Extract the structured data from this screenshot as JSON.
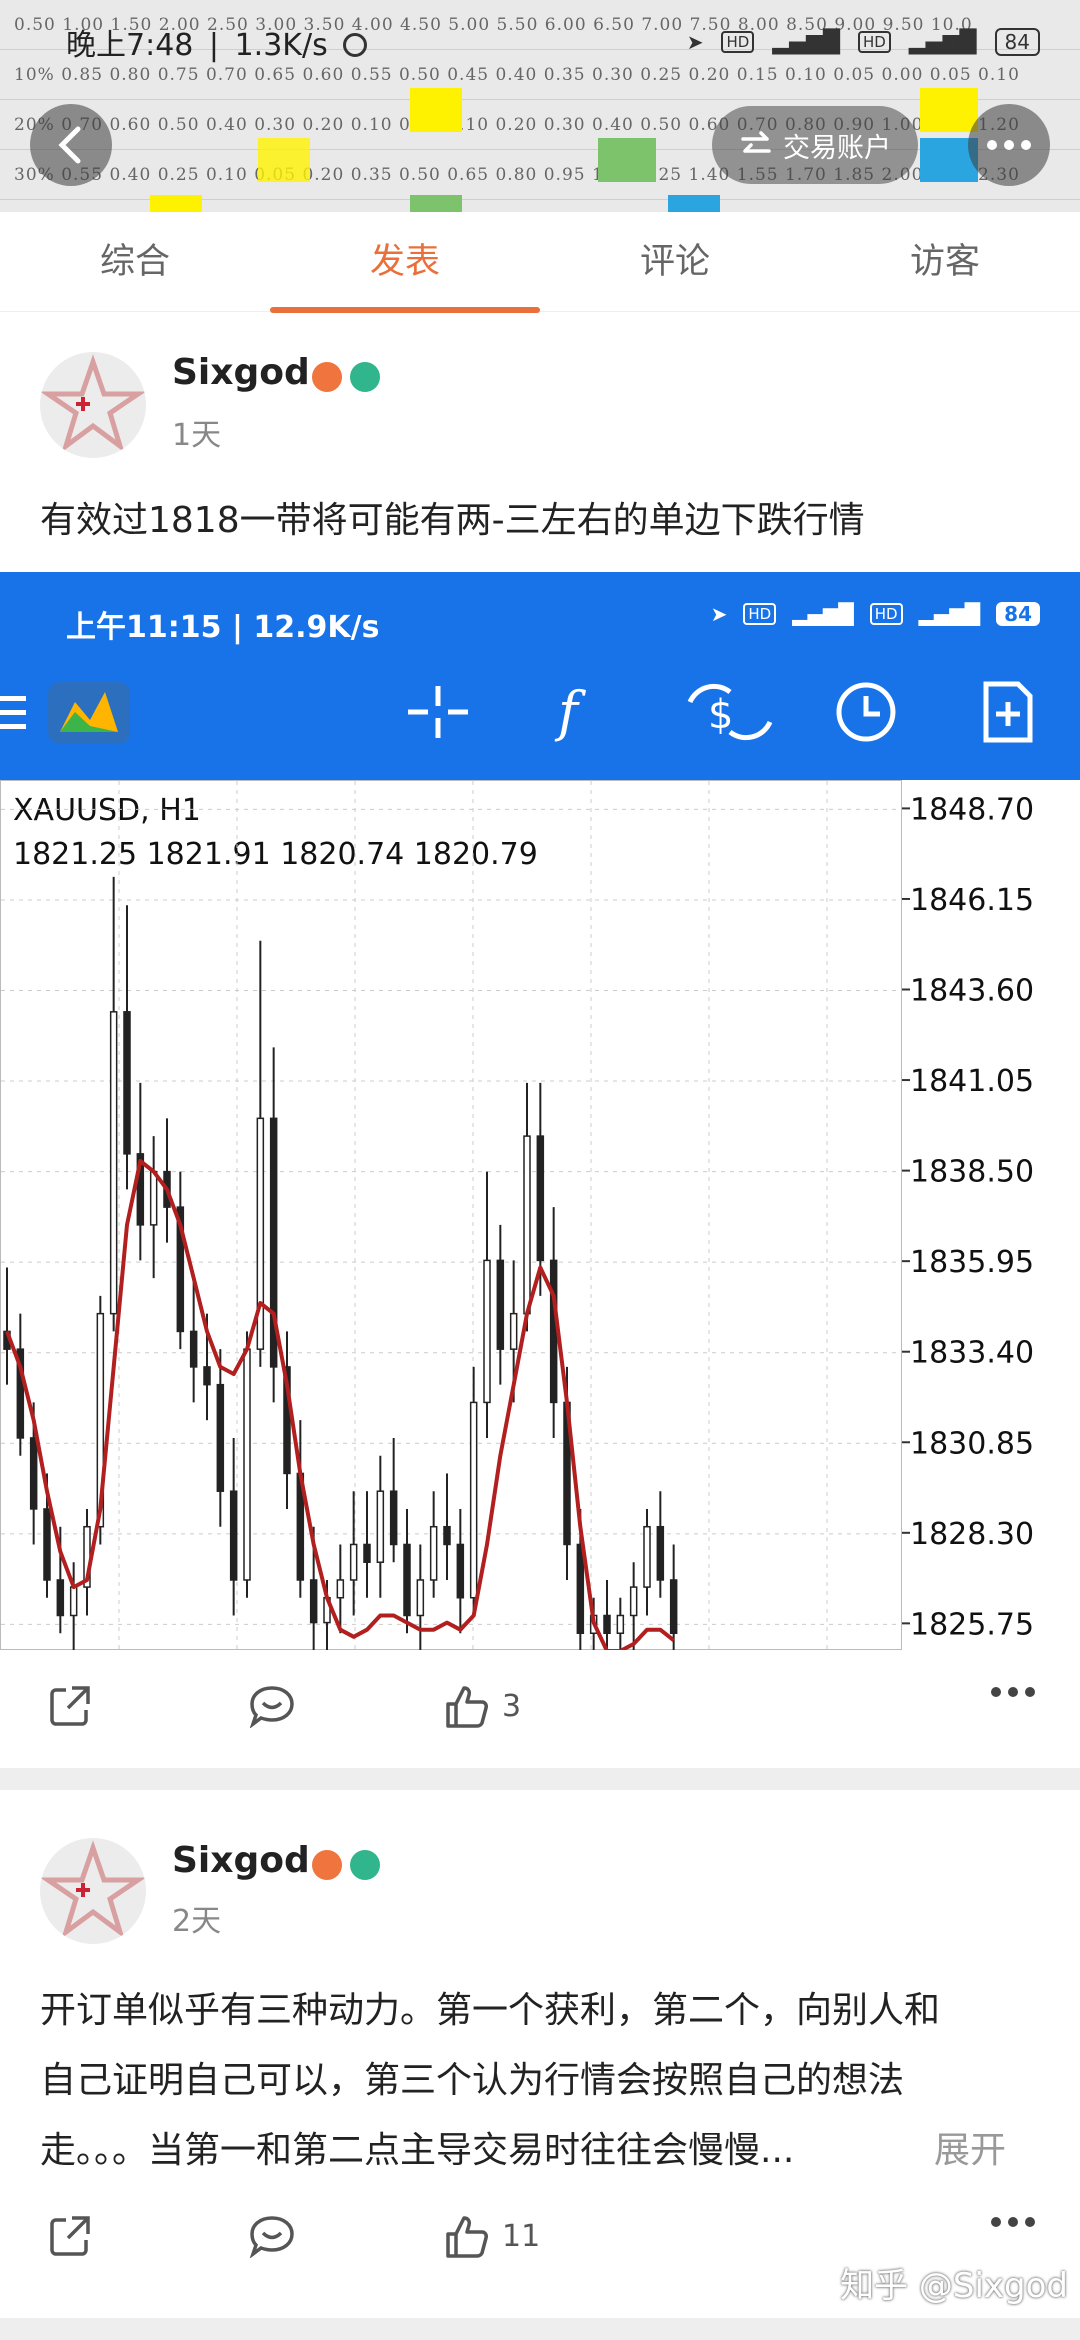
{
  "header": {
    "time": "晚上7:48",
    "speed": "1.3K/s",
    "battery": "84",
    "trade_account": "交易账户",
    "bg_numbers": [
      "0.50 1.00 1.50 2.00 2.50 3.00 3.50 4.00 4.50 5.00 5.50 6.00 6.50 7.00 7.50 8.00 8.50 9.00 9.50 10.0",
      "10% 0.85 0.80 0.75 0.70 0.65 0.60 0.55 0.50 0.45 0.40 0.35 0.30 0.25 0.20 0.15 0.10 0.05 0.00 0.05 0.10",
      "20% 0.70 0.60 0.50 0.40 0.30 0.20 0.10 0.00 0.10 0.20 0.30 0.40 0.50 0.60 0.70 0.80 0.90 1.00 1.10 1.20",
      "30% 0.55 0.40 0.25 0.10 0.05 0.20 0.35 0.50 0.65 0.80 0.95 1.10 1.25 1.40 1.55 1.70 1.85 2.00 2.15 2.30"
    ]
  },
  "tabs": [
    "综合",
    "发表",
    "评论",
    "访客"
  ],
  "active_tab": 1,
  "posts": [
    {
      "username": "Sixgod",
      "time": "1天",
      "text": "有效过1818一带将可能有两-三左右的单边下跌行情",
      "likes": "3"
    },
    {
      "username": "Sixgod",
      "time": "2天",
      "text_lines": [
        "开订单似乎有三种动力。第一个获利，第二个，向别人和",
        "自己证明自己可以，第三个认为行情会按照自己的想法",
        "走。。。当第一和第二点主导交易时往往会慢慢..."
      ],
      "expand": "展开",
      "likes": "11"
    }
  ],
  "inner_screenshot": {
    "time": "上午11:15",
    "speed": "12.9K/s",
    "battery": "84",
    "symbol": "XAUUSD, H1",
    "ohlc": "1821.25 1821.91 1820.74 1820.79"
  },
  "watermark": "知乎 @Sixgod",
  "chart_data": {
    "type": "candlestick",
    "symbol": "XAUUSD",
    "timeframe": "H1",
    "ylim": [
      1825.0,
      1849.5
    ],
    "y_ticks": [
      "1848.70",
      "1846.15",
      "1843.60",
      "1841.05",
      "1838.50",
      "1835.95",
      "1833.40",
      "1830.85",
      "1828.30",
      "1825.75"
    ],
    "y_tick_values": [
      1848.7,
      1846.15,
      1843.6,
      1841.05,
      1838.5,
      1835.95,
      1833.4,
      1830.85,
      1828.3,
      1825.75
    ],
    "bars": [
      [
        1834.0,
        1835.8,
        1832.5,
        1833.5
      ],
      [
        1833.5,
        1834.5,
        1830.5,
        1831.0
      ],
      [
        1831.0,
        1832.0,
        1828.0,
        1829.0
      ],
      [
        1829.0,
        1830.0,
        1826.5,
        1827.0
      ],
      [
        1827.0,
        1828.5,
        1825.5,
        1826.0
      ],
      [
        1826.0,
        1827.5,
        1825.0,
        1826.8
      ],
      [
        1826.8,
        1829.0,
        1826.0,
        1828.5
      ],
      [
        1828.5,
        1835.0,
        1828.0,
        1834.5
      ],
      [
        1834.5,
        1846.8,
        1834.0,
        1843.0
      ],
      [
        1843.0,
        1846.0,
        1838.0,
        1839.0
      ],
      [
        1839.0,
        1841.0,
        1836.0,
        1837.0
      ],
      [
        1837.0,
        1839.5,
        1835.5,
        1838.5
      ],
      [
        1838.5,
        1840.0,
        1836.5,
        1837.5
      ],
      [
        1837.5,
        1838.5,
        1833.5,
        1834.0
      ],
      [
        1834.0,
        1835.5,
        1832.0,
        1833.0
      ],
      [
        1833.0,
        1834.5,
        1831.5,
        1832.5
      ],
      [
        1832.5,
        1833.5,
        1828.5,
        1829.5
      ],
      [
        1829.5,
        1831.0,
        1826.0,
        1827.0
      ],
      [
        1827.0,
        1834.0,
        1826.5,
        1833.5
      ],
      [
        1833.5,
        1845.0,
        1833.0,
        1840.0
      ],
      [
        1840.0,
        1842.0,
        1832.0,
        1833.0
      ],
      [
        1833.0,
        1834.0,
        1829.0,
        1830.0
      ],
      [
        1830.0,
        1831.5,
        1826.5,
        1827.0
      ],
      [
        1827.0,
        1828.5,
        1825.0,
        1825.8
      ],
      [
        1825.8,
        1827.0,
        1825.0,
        1826.5
      ],
      [
        1826.5,
        1828.0,
        1825.5,
        1827.0
      ],
      [
        1827.0,
        1829.5,
        1826.0,
        1828.0
      ],
      [
        1828.0,
        1829.5,
        1826.5,
        1827.5
      ],
      [
        1827.5,
        1830.5,
        1826.5,
        1829.5
      ],
      [
        1829.5,
        1831.0,
        1827.5,
        1828.0
      ],
      [
        1828.0,
        1829.0,
        1825.5,
        1826.0
      ],
      [
        1826.0,
        1828.0,
        1825.0,
        1827.0
      ],
      [
        1827.0,
        1829.5,
        1826.5,
        1828.5
      ],
      [
        1828.5,
        1830.0,
        1827.0,
        1828.0
      ],
      [
        1828.0,
        1829.0,
        1825.5,
        1826.5
      ],
      [
        1826.5,
        1833.0,
        1826.0,
        1832.0
      ],
      [
        1832.0,
        1838.5,
        1831.0,
        1836.0
      ],
      [
        1836.0,
        1837.0,
        1832.5,
        1833.5
      ],
      [
        1833.5,
        1836.0,
        1832.0,
        1834.5
      ],
      [
        1834.5,
        1841.0,
        1834.0,
        1839.5
      ],
      [
        1839.5,
        1841.0,
        1835.0,
        1836.0
      ],
      [
        1836.0,
        1837.5,
        1831.0,
        1832.0
      ],
      [
        1832.0,
        1833.0,
        1827.0,
        1828.0
      ],
      [
        1828.0,
        1829.0,
        1825.0,
        1825.5
      ],
      [
        1825.5,
        1826.5,
        1825.0,
        1826.0
      ],
      [
        1826.0,
        1827.0,
        1825.0,
        1825.5
      ],
      [
        1825.5,
        1826.5,
        1825.0,
        1826.0
      ],
      [
        1826.0,
        1827.5,
        1825.0,
        1826.8
      ],
      [
        1826.8,
        1829.0,
        1826.0,
        1828.5
      ],
      [
        1828.5,
        1829.5,
        1826.5,
        1827.0
      ],
      [
        1827.0,
        1828.0,
        1825.0,
        1825.5
      ]
    ],
    "ma": [
      1834.0,
      1833.0,
      1831.5,
      1829.5,
      1827.8,
      1826.8,
      1827.0,
      1829.0,
      1833.0,
      1837.0,
      1838.8,
      1838.5,
      1838.0,
      1837.0,
      1835.5,
      1834.0,
      1833.0,
      1832.8,
      1833.5,
      1834.8,
      1834.5,
      1832.5,
      1830.0,
      1828.0,
      1826.5,
      1825.6,
      1825.4,
      1825.6,
      1826.0,
      1826.0,
      1825.8,
      1825.6,
      1825.6,
      1825.8,
      1825.6,
      1826.0,
      1828.0,
      1830.5,
      1832.5,
      1834.5,
      1835.8,
      1835.0,
      1832.0,
      1828.5,
      1825.8,
      1825.0,
      1825.0,
      1825.2,
      1825.6,
      1825.6,
      1825.3
    ]
  }
}
